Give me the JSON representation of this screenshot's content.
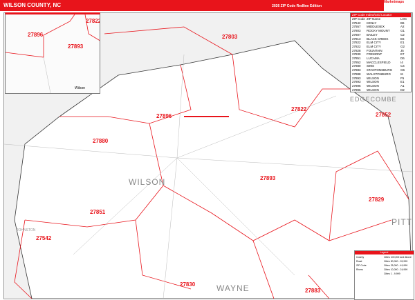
{
  "header": {
    "title": "WILSON COUNTY, NC",
    "edition": "2026 ZIP Code Redline Edition",
    "logo": "Marketmaps"
  },
  "inset": {
    "zips": [
      "27896",
      "27893",
      "27822"
    ],
    "city": "Wilson"
  },
  "zip_table": {
    "title": "ZIP Code Index/Grid Locator",
    "columns": [
      "ZIP Code",
      "ZIP Name",
      "LOC"
    ],
    "rows": [
      [
        "27542",
        "KENLY",
        "B6"
      ],
      [
        "27557",
        "MIDDLESEX",
        "A2"
      ],
      [
        "27803",
        "ROCKY MOUNT",
        "G1"
      ],
      [
        "27807",
        "BAILEY",
        "C2"
      ],
      [
        "27813",
        "BLACK CREEK",
        "E6"
      ],
      [
        "27822",
        "ELM CITY",
        "E1"
      ],
      [
        "27822",
        "ELM CITY",
        "G2"
      ],
      [
        "27828",
        "FOUNTAIN",
        "J5"
      ],
      [
        "27830",
        "FREMONT",
        "E7"
      ],
      [
        "27851",
        "LUCAMA",
        "D6"
      ],
      [
        "27852",
        "MACCLESFIELD",
        "I4"
      ],
      [
        "27880",
        "SIMS",
        "C4"
      ],
      [
        "27883",
        "STANTONSBURG",
        "G6"
      ],
      [
        "27888",
        "WALSTONBURG",
        "I6"
      ],
      [
        "27893",
        "WILSON",
        "F5"
      ],
      [
        "27893",
        "WILSON",
        "E1"
      ],
      [
        "27896",
        "WILSON",
        "A1"
      ],
      [
        "27896",
        "WILSON",
        "D2"
      ]
    ]
  },
  "map": {
    "zips": [
      "27803",
      "27822",
      "27896",
      "27880",
      "27852",
      "27893",
      "27851",
      "27829",
      "27542",
      "27830",
      "27883"
    ],
    "counties": [
      "WILSON",
      "EDGECOMBE",
      "PITT",
      "WAYNE",
      "JOHNSTON"
    ]
  },
  "legend": {
    "title": "Legend",
    "items": [
      "County",
      "Road",
      "ZIP Code",
      "Rivers"
    ],
    "city_sizes": [
      "Cities 100,000 and Above",
      "Cities 50,000 - 99,999",
      "Cities 25,000 - 49,999",
      "Cities 10,000 - 24,999",
      "Cities 1 - 9,999"
    ]
  }
}
